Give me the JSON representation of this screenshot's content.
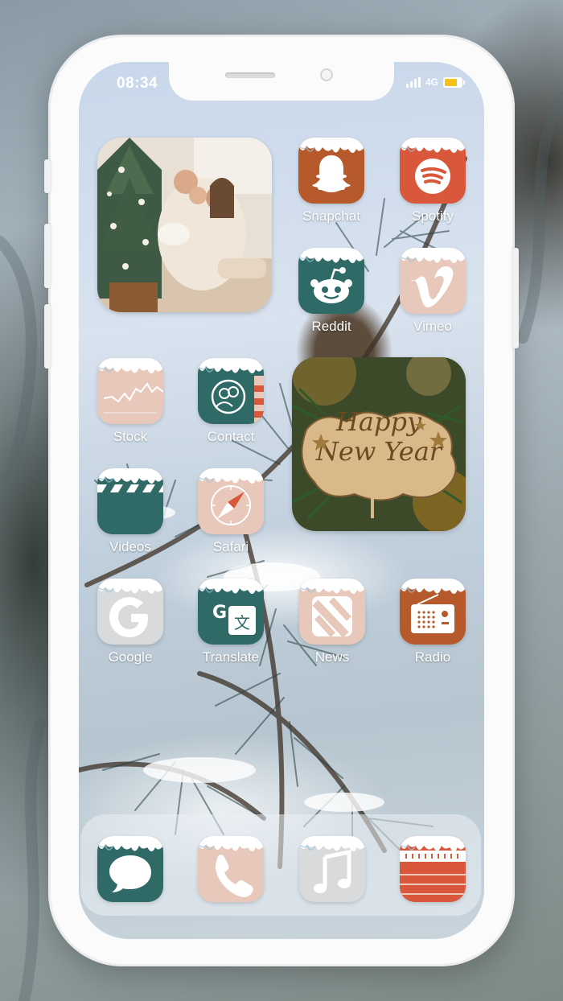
{
  "status_bar": {
    "time": "08:34",
    "network": "4G"
  },
  "widgets": {
    "family_photo": {
      "description_icon": "photo-widget"
    },
    "new_year": {
      "line1": "Happy",
      "line2": "New Year"
    }
  },
  "apps": [
    {
      "id": "snapchat",
      "label": "Snapchat",
      "icon": "ghost-icon",
      "color": "#b65a2b"
    },
    {
      "id": "spotify",
      "label": "Spotify",
      "icon": "spotify-icon",
      "color": "#d9583b"
    },
    {
      "id": "reddit",
      "label": "Reddit",
      "icon": "reddit-alien-icon",
      "color": "#2f6a66"
    },
    {
      "id": "vimeo",
      "label": "Vimeo",
      "icon": "vimeo-icon",
      "color": "#e8c8bb"
    },
    {
      "id": "stock",
      "label": "Stock",
      "icon": "stock-chart-icon",
      "color": "#e8c8bb"
    },
    {
      "id": "contact",
      "label": "Contact",
      "icon": "contacts-icon",
      "color": "#2f6a66"
    },
    {
      "id": "videos",
      "label": "Videos",
      "icon": "clapperboard-icon",
      "color": "#2f6a66"
    },
    {
      "id": "safari",
      "label": "Safari",
      "icon": "compass-icon",
      "color": "#e8c8bb"
    },
    {
      "id": "google",
      "label": "Google",
      "icon": "google-icon",
      "color": "#d8dadc"
    },
    {
      "id": "translate",
      "label": "Translate",
      "icon": "translate-icon",
      "color": "#2f6a66"
    },
    {
      "id": "news",
      "label": "News",
      "icon": "news-icon",
      "color": "#e8c8bb"
    },
    {
      "id": "radio",
      "label": "Radio",
      "icon": "radio-icon",
      "color": "#b65a2b"
    }
  ],
  "dock": [
    {
      "id": "messages",
      "icon": "speech-bubble-icon",
      "color": "#2f6a66"
    },
    {
      "id": "phone",
      "icon": "phone-handset-icon",
      "color": "#e8c8bb"
    },
    {
      "id": "music",
      "icon": "music-note-icon",
      "color": "#d8dadc"
    },
    {
      "id": "calendar",
      "icon": "calendar-icon",
      "color": "#d9583b"
    }
  ],
  "palette": {
    "teal": "#2f6a66",
    "rust": "#b65a2b",
    "coral": "#d9583b",
    "blush": "#e8c8bb",
    "silver": "#d8dadc",
    "snow": "#ffffff"
  }
}
